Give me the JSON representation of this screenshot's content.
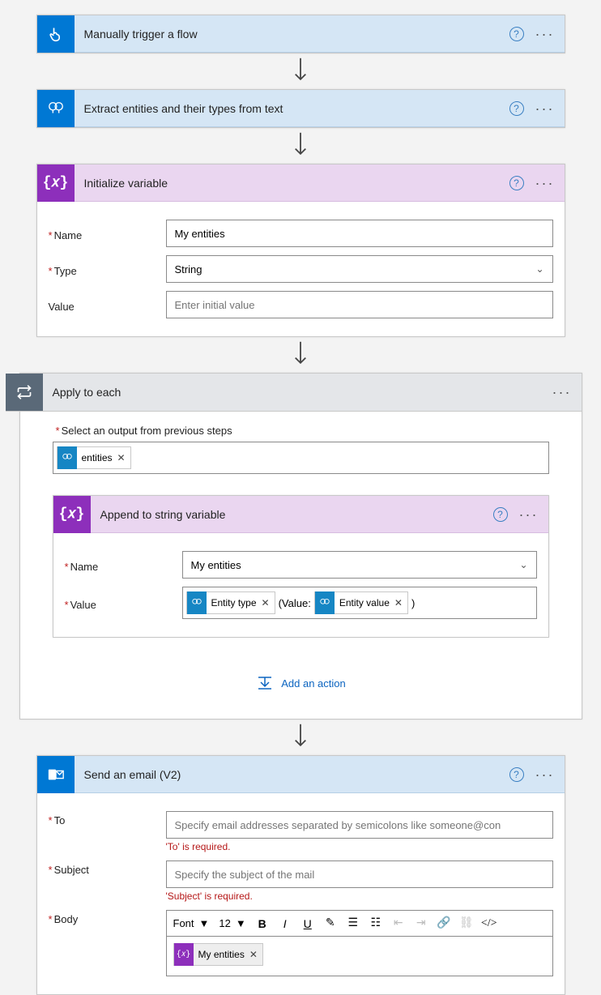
{
  "steps": {
    "trigger": {
      "title": "Manually trigger a flow"
    },
    "extract": {
      "title": "Extract entities and their types from text"
    },
    "initvar": {
      "title": "Initialize variable",
      "fields": {
        "name_label": "Name",
        "name_value": "My entities",
        "type_label": "Type",
        "type_value": "String",
        "value_label": "Value",
        "value_placeholder": "Enter initial value"
      }
    },
    "apply": {
      "title": "Apply to each",
      "select_label": "Select an output from previous steps",
      "token_entities": "entities",
      "add_action": "Add an action"
    },
    "append": {
      "title": "Append to string variable",
      "name_label": "Name",
      "name_value": "My entities",
      "value_label": "Value",
      "token_type": "Entity type",
      "value_mid": "(Value:",
      "token_value": "Entity value",
      "value_end": ")"
    },
    "email": {
      "title": "Send an email (V2)",
      "to_label": "To",
      "to_placeholder": "Specify email addresses separated by semicolons like someone@con",
      "to_error": "'To' is required.",
      "subject_label": "Subject",
      "subject_placeholder": "Specify the subject of the mail",
      "subject_error": "'Subject' is required.",
      "body_label": "Body",
      "toolbar": {
        "font": "Font",
        "size": "12"
      },
      "body_token": "My entities"
    }
  }
}
